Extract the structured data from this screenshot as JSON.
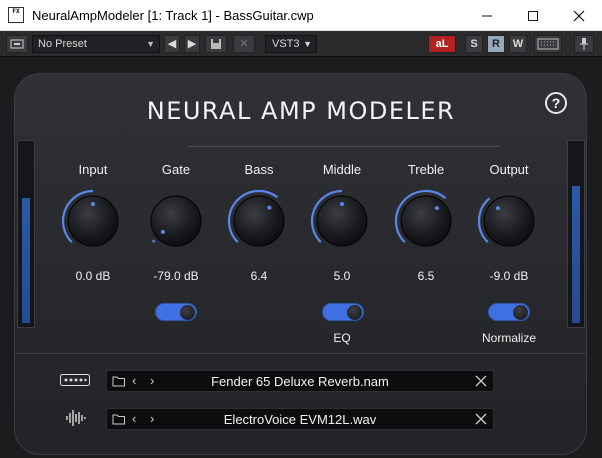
{
  "window": {
    "app_icon_text": "FX",
    "title": "NeuralAmpModeler [1: Track 1] - BassGuitar.cwp"
  },
  "toolbar": {
    "preset": "No Preset",
    "plugin_format": "VST3",
    "letters": {
      "a": "aL",
      "s": "S",
      "r": "R",
      "w": "W"
    }
  },
  "plugin": {
    "brand": "NEURAL AMP MODELER",
    "help": "?",
    "knobs": [
      {
        "label": "Input",
        "value": "0.0 dB",
        "level": 0.5
      },
      {
        "label": "Gate",
        "value": "-79.0 dB",
        "level": 0.02
      },
      {
        "label": "Bass",
        "value": "6.4",
        "level": 0.64
      },
      {
        "label": "Middle",
        "value": "5.0",
        "level": 0.5
      },
      {
        "label": "Treble",
        "value": "6.5",
        "level": 0.65
      },
      {
        "label": "Output",
        "value": "-9.0 dB",
        "level": 0.35
      }
    ],
    "toggles": {
      "gate_on": true,
      "eq_label": "EQ",
      "eq_on": true,
      "normalize_label": "Normalize",
      "normalize_on": true
    },
    "meters": {
      "input_level": 0.7,
      "output_level": 0.77
    },
    "model_file": "Fender 65 Deluxe Reverb.nam",
    "ir_file": "ElectroVoice EVM12L.wav"
  },
  "colors": {
    "accent": "#3f6fe0",
    "knob_arc": "#5a86ea"
  }
}
